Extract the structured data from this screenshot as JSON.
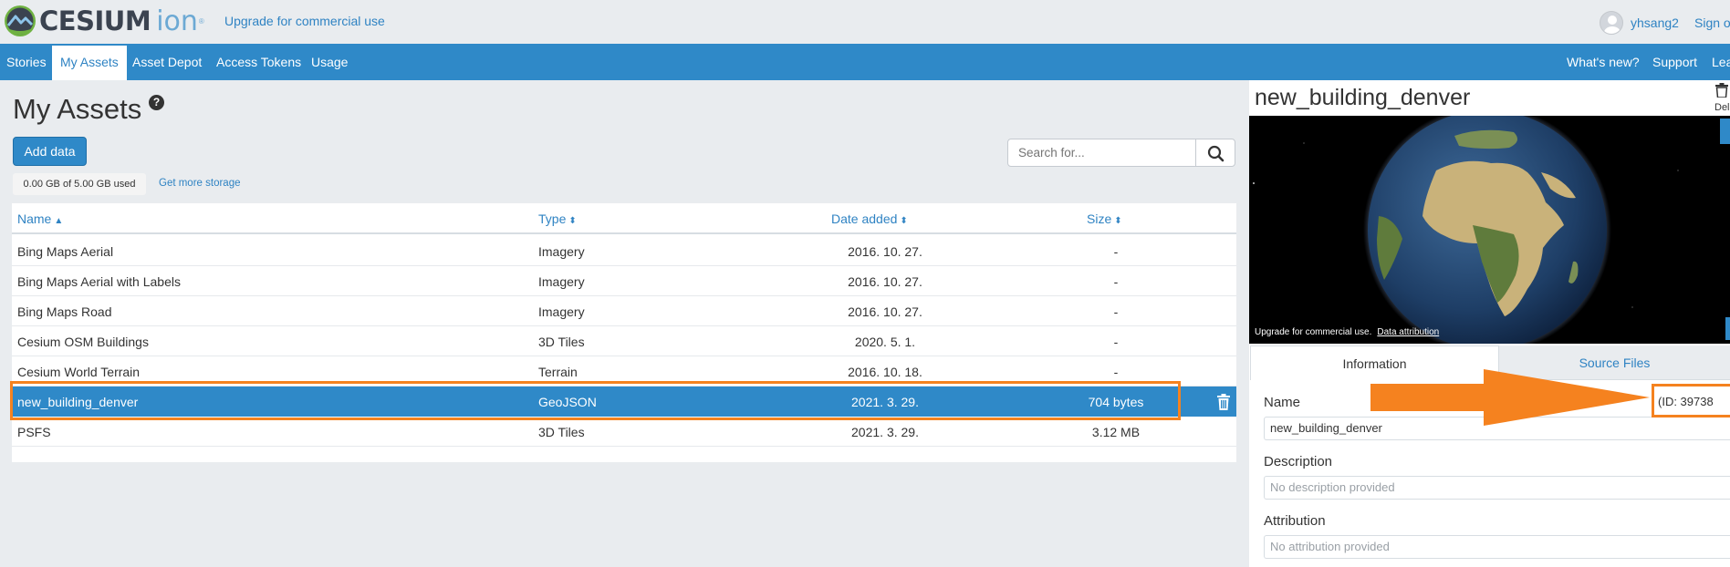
{
  "header": {
    "logo_text": "CESIUM",
    "logo_ion": "ion",
    "logo_tm": "®",
    "upgrade_link": "Upgrade for commercial use",
    "username": "yhsang2",
    "signout": "Sign o"
  },
  "nav": {
    "items": [
      "Stories",
      "My Assets",
      "Asset Depot",
      "Access Tokens",
      "Usage"
    ],
    "active": "My Assets",
    "right_items": [
      "What's new?",
      "Support",
      "Lea"
    ]
  },
  "page": {
    "title": "My Assets",
    "help_icon": "?",
    "add_button": "Add data",
    "storage": "0.00 GB of 5.00 GB used",
    "more_storage": "Get more storage",
    "search_placeholder": "Search for..."
  },
  "table": {
    "columns": [
      {
        "label": "Name",
        "sort": "▲"
      },
      {
        "label": "Type",
        "sort": "⬍"
      },
      {
        "label": "Date added",
        "sort": "⬍"
      },
      {
        "label": "Size",
        "sort": "⬍"
      }
    ],
    "rows": [
      {
        "name": "Bing Maps Aerial",
        "type": "Imagery",
        "date": "2016. 10. 27.",
        "size": "-"
      },
      {
        "name": "Bing Maps Aerial with Labels",
        "type": "Imagery",
        "date": "2016. 10. 27.",
        "size": "-"
      },
      {
        "name": "Bing Maps Road",
        "type": "Imagery",
        "date": "2016. 10. 27.",
        "size": "-"
      },
      {
        "name": "Cesium OSM Buildings",
        "type": "3D Tiles",
        "date": "2020. 5. 1.",
        "size": "-"
      },
      {
        "name": "Cesium World Terrain",
        "type": "Terrain",
        "date": "2016. 10. 18.",
        "size": "-"
      },
      {
        "name": "new_building_denver",
        "type": "GeoJSON",
        "date": "2021. 3. 29.",
        "size": "704 bytes",
        "selected": true
      },
      {
        "name": "PSFS",
        "type": "3D Tiles",
        "date": "2021. 3. 29.",
        "size": "3.12 MB"
      }
    ]
  },
  "detail": {
    "title": "new_building_denver",
    "delete_label": "Del",
    "viewer_credit": "Upgrade for commercial use.",
    "viewer_attribution": "Data attribution",
    "tabs": [
      "Information",
      "Source Files"
    ],
    "active_tab": "Information",
    "name_label": "Name",
    "name_value": "new_building_denver",
    "id_text": "(ID:   39738",
    "description_label": "Description",
    "description_value": "No description provided",
    "attribution_label": "Attribution",
    "attribution_value": "No attribution provided"
  },
  "colors": {
    "brand_blue": "#2f89c8",
    "link_blue": "#2f83c3",
    "annotation_orange": "#f5821f"
  }
}
